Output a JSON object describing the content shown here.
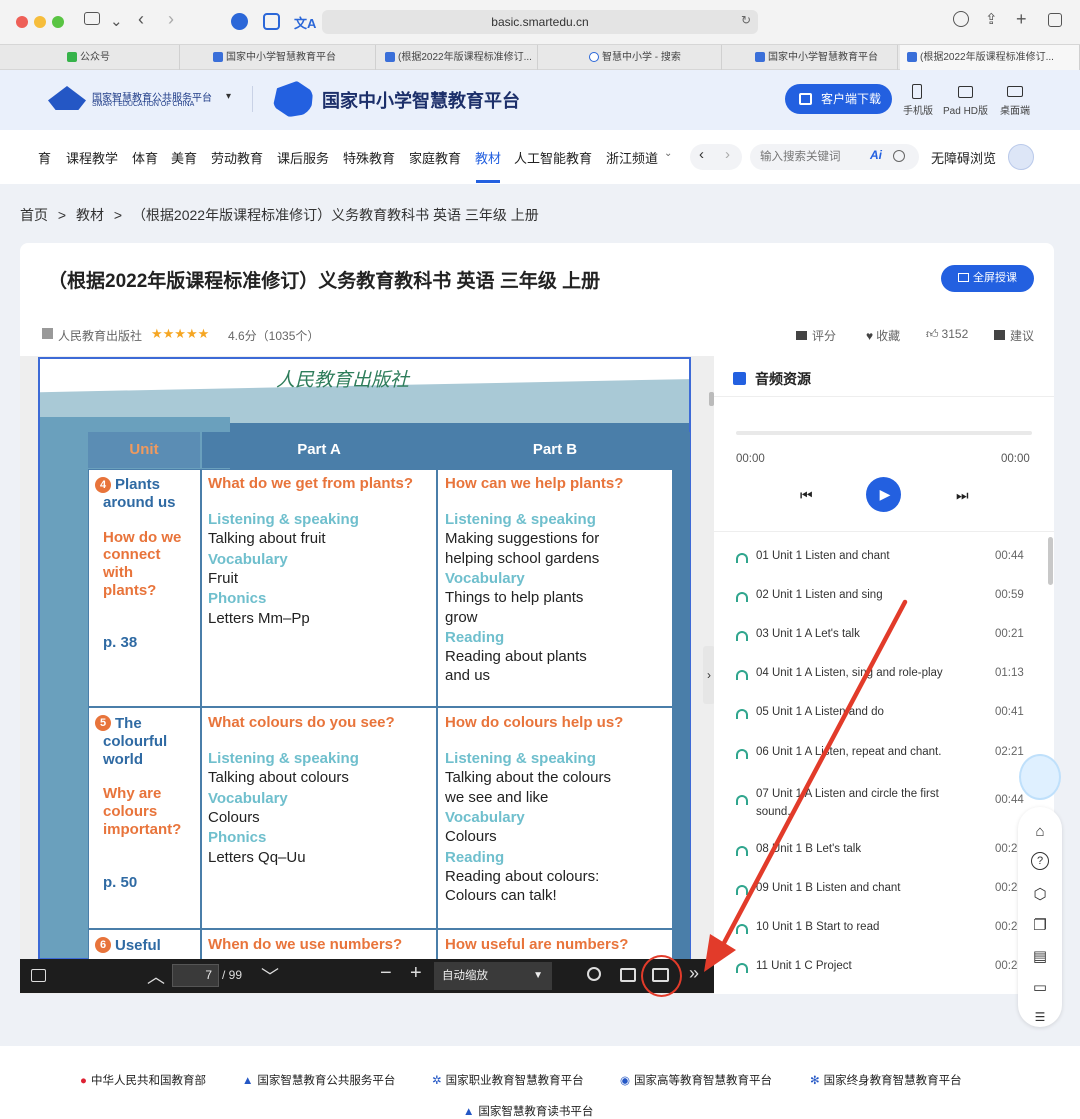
{
  "browser": {
    "url": "basic.smartedu.cn",
    "tabs": [
      "公众号",
      "国家中小学智慧教育平台",
      "(根据2022年版课程标准修订...",
      "智慧中小学 - 搜索",
      "国家中小学智慧教育平台",
      "(根据2022年版课程标准修订..."
    ]
  },
  "header": {
    "logo_cn": "国家智慧教育公共服务平台",
    "logo_en": "SMART EDUCATION OF CHINA",
    "platform_title": "国家中小学智慧教育平台",
    "download_btn": "客户端下载",
    "devices": [
      "手机版",
      "Pad HD版",
      "桌面端"
    ]
  },
  "nav": {
    "items": [
      "育",
      "课程教学",
      "体育",
      "美育",
      "劳动教育",
      "课后服务",
      "特殊教育",
      "家庭教育",
      "教材",
      "人工智能教育",
      "浙江频道"
    ],
    "active": "教材",
    "search_placeholder": "输入搜索关键词",
    "accessibility": "无障碍浏览"
  },
  "breadcrumb": [
    "首页",
    "教材",
    "（根据2022年版课程标准修订）义务教育教科书 英语 三年级 上册"
  ],
  "book": {
    "title": "（根据2022年版课程标准修订）义务教育教科书 英语 三年级 上册",
    "fullscreen_btn": "全屏授课",
    "publisher": "人民教育出版社",
    "rating": "4.6分（1035个）",
    "rating_value": 4.6,
    "actions": [
      "评分",
      "收藏",
      "3152",
      "建议"
    ]
  },
  "page_content": {
    "publisher_logo": "人民教育出版社",
    "headers": [
      "Unit",
      "Part A",
      "Part B"
    ],
    "units": [
      {
        "num": "4",
        "name": [
          "Plants",
          "around us"
        ],
        "question": [
          "How do we",
          "connect",
          "with",
          "plants?"
        ],
        "page": "p. 38",
        "a": {
          "title": "What do we get from plants?",
          "lines": [
            [
              "t",
              "Listening & speaking"
            ],
            [
              "k",
              "Talking about fruit"
            ],
            [
              "t",
              "Vocabulary"
            ],
            [
              "k",
              "Fruit"
            ],
            [
              "t",
              "Phonics"
            ],
            [
              "k",
              "Letters Mm–Pp"
            ]
          ]
        },
        "b": {
          "title": "How can we help plants?",
          "lines": [
            [
              "t",
              "Listening & speaking"
            ],
            [
              "k",
              "Making suggestions for"
            ],
            [
              "k",
              "helping school gardens"
            ],
            [
              "t",
              "Vocabulary"
            ],
            [
              "k",
              "Things to help plants"
            ],
            [
              "k",
              "grow"
            ],
            [
              "t",
              "Reading"
            ],
            [
              "k",
              "Reading about plants"
            ],
            [
              "k",
              "and us"
            ]
          ]
        }
      },
      {
        "num": "5",
        "name": [
          "The",
          "colourful",
          "world"
        ],
        "question": [
          "Why are",
          "colours",
          "important?"
        ],
        "page": "p. 50",
        "a": {
          "title": "What colours do you see?",
          "lines": [
            [
              "t",
              "Listening & speaking"
            ],
            [
              "k",
              "Talking about colours"
            ],
            [
              "t",
              "Vocabulary"
            ],
            [
              "k",
              "Colours"
            ],
            [
              "t",
              "Phonics"
            ],
            [
              "k",
              "Letters Qq–Uu"
            ]
          ]
        },
        "b": {
          "title": "How do colours help us?",
          "lines": [
            [
              "t",
              "Listening & speaking"
            ],
            [
              "k",
              "Talking about the colours"
            ],
            [
              "k",
              "we see and like"
            ],
            [
              "t",
              "Vocabulary"
            ],
            [
              "k",
              "Colours"
            ],
            [
              "t",
              "Reading"
            ],
            [
              "k",
              "Reading about colours:"
            ],
            [
              "k",
              "Colours can talk!"
            ]
          ]
        }
      },
      {
        "num": "6",
        "name": [
          "Useful"
        ],
        "a_title": "When do we use numbers?",
        "b_title": "How useful are numbers?"
      }
    ]
  },
  "toolbar": {
    "page": "7",
    "total": "/ 99",
    "zoom": "自动缩放"
  },
  "audio": {
    "title": "音频资源",
    "time_start": "00:00",
    "time_end": "00:00",
    "tracks": [
      {
        "name": "01 Unit 1 Listen and chant",
        "dur": "00:44"
      },
      {
        "name": "02 Unit 1 Listen and sing",
        "dur": "00:59"
      },
      {
        "name": "03 Unit 1 A Let's talk",
        "dur": "00:21"
      },
      {
        "name": "04 Unit 1 A Listen, sing and role-play",
        "dur": "01:13"
      },
      {
        "name": "05 Unit 1 A Listen and do",
        "dur": "00:41"
      },
      {
        "name": "06 Unit 1 A Listen, repeat and chant.",
        "dur": "02:21"
      },
      {
        "name": "07 Unit 1 A Listen and circle the first sound.",
        "dur": "00:44"
      },
      {
        "name": "08 Unit 1 B Let's talk",
        "dur": "00:2"
      },
      {
        "name": "09 Unit 1 B Listen and chant",
        "dur": "00:2"
      },
      {
        "name": "10 Unit 1 B Start to read",
        "dur": "00:2"
      },
      {
        "name": "11 Unit 1 C Project",
        "dur": "00:2"
      }
    ]
  },
  "footer": {
    "links": [
      "中华人民共和国教育部",
      "国家智慧教育公共服务平台",
      "国家职业教育智慧教育平台",
      "国家高等教育智慧教育平台",
      "国家终身教育智慧教育平台",
      "国家智慧教育读书平台"
    ]
  },
  "colors": {
    "accent": "#2360e0",
    "unit_orange": "#e8743b",
    "teal": "#6fbfcd",
    "book_blue": "#4a7ea9",
    "annotation_red": "#e23b2a"
  }
}
